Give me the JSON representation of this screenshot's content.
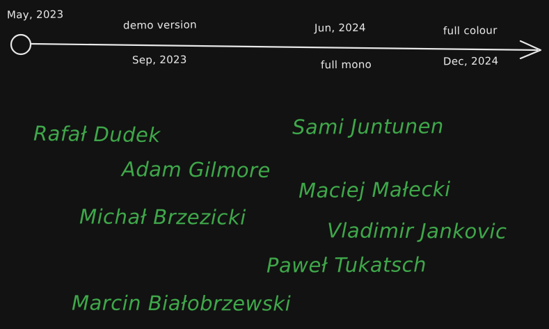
{
  "colors": {
    "background": "#121212",
    "timeline": "#e8e8e8",
    "names": "#3fa84a"
  },
  "timeline": {
    "milestones": [
      {
        "date": "May, 2023",
        "label": ""
      },
      {
        "date": "Sep, 2023",
        "label": "demo version"
      },
      {
        "date": "Jun, 2024",
        "label": "full mono"
      },
      {
        "date": "Dec, 2024",
        "label": "full colour"
      }
    ]
  },
  "names": [
    "Rafał Dudek",
    "Sami Juntunen",
    "Adam Gilmore",
    "Maciej Małecki",
    "Michał Brzezicki",
    "Vladimir Jankovic",
    "Paweł Tukatsch",
    "Marcin Białobrzewski"
  ]
}
